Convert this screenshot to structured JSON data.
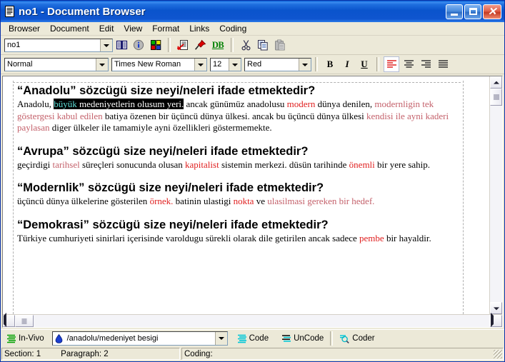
{
  "window": {
    "title": "no1 - Document Browser",
    "title_icon": "document-icon",
    "buttons": {
      "minimize": "minimize-button",
      "maximize": "maximize-button",
      "close": "close-button"
    }
  },
  "menubar": {
    "items": [
      {
        "label": "Browser"
      },
      {
        "label": "Document"
      },
      {
        "label": "Edit"
      },
      {
        "label": "View"
      },
      {
        "label": "Format"
      },
      {
        "label": "Links"
      },
      {
        "label": "Coding"
      }
    ]
  },
  "toolbar_main": {
    "document_combo": {
      "value": "no1"
    },
    "buttons": [
      {
        "name": "book-icon",
        "title": "Browse"
      },
      {
        "name": "info-icon",
        "title": "Properties"
      },
      {
        "name": "attributes-grid-icon",
        "title": "Attributes"
      },
      {
        "name": "document-export-icon",
        "title": "Export"
      },
      {
        "name": "pushpin-icon",
        "title": "Pin"
      },
      {
        "name": "db-icon",
        "title": "DB",
        "label": "DB"
      },
      {
        "name": "cut-icon",
        "title": "Cut"
      },
      {
        "name": "copy-icon",
        "title": "Copy"
      },
      {
        "name": "paste-icon",
        "title": "Paste"
      }
    ]
  },
  "toolbar_format": {
    "style_combo": {
      "value": "Normal"
    },
    "font_combo": {
      "value": "Times New Roman"
    },
    "size_combo": {
      "value": "12"
    },
    "color_combo": {
      "value": "Red"
    },
    "bold_label": "B",
    "italic_label": "I",
    "underline_label": "U",
    "align_buttons": [
      {
        "name": "align-left-button",
        "active": true
      },
      {
        "name": "align-center-button",
        "active": false
      },
      {
        "name": "align-right-button",
        "active": false
      },
      {
        "name": "align-justify-button",
        "active": false
      }
    ]
  },
  "document": {
    "sections": [
      {
        "heading": "“Anadolu” sözcügü size neyi/neleri ifade etmektedir?",
        "para_parts": [
          {
            "text": "Anadolu, ",
            "style": "plain"
          },
          {
            "text": "büyük",
            "style": "selected-teal"
          },
          {
            "text": " medeniyetlerin olusum yeri.",
            "style": "selected"
          },
          {
            "text": " ancak günümüz anadolusu ",
            "style": "plain"
          },
          {
            "text": "modern",
            "style": "red"
          },
          {
            "text": " dünya denilen, ",
            "style": "plain"
          },
          {
            "text": "modernligin tek göstergesi kabul edilen",
            "style": "red2"
          },
          {
            "text": " batiya özenen bir üçüncü dünya ülkesi. ancak bu üçüncü dünya ülkesi ",
            "style": "plain"
          },
          {
            "text": "kendisi ile ayni kaderi paylasan",
            "style": "red2"
          },
          {
            "text": " diger ülkeler ile tamamiyle ayni özellikleri göstermemekte.",
            "style": "plain"
          }
        ]
      },
      {
        "heading": "“Avrupa” sözcügü size neyi/neleri ifade etmektedir?",
        "para_parts": [
          {
            "text": "geçirdigi ",
            "style": "plain"
          },
          {
            "text": "tarihsel",
            "style": "red2"
          },
          {
            "text": " süreçleri sonucunda olusan ",
            "style": "plain"
          },
          {
            "text": "kapitalist",
            "style": "red"
          },
          {
            "text": " sistemin merkezi. düsün tarihinde ",
            "style": "plain"
          },
          {
            "text": "önemli",
            "style": "red"
          },
          {
            "text": " bir yere sahip.",
            "style": "plain"
          }
        ]
      },
      {
        "heading": "“Modernlik” sözcügü size neyi/neleri ifade etmektedir?",
        "para_parts": [
          {
            "text": "üçüncü dünya ülkelerine gösterilen ",
            "style": "plain"
          },
          {
            "text": "örnek.",
            "style": "red"
          },
          {
            "text": " batinin ulastigi ",
            "style": "plain"
          },
          {
            "text": "nokta",
            "style": "red"
          },
          {
            "text": " ve ",
            "style": "plain"
          },
          {
            "text": "ulasilmasi gereken bir hedef.",
            "style": "red2"
          }
        ]
      },
      {
        "heading": "“Demokrasi” sözcügü size neyi/neleri ifade etmektedir?",
        "para_parts": [
          {
            "text": "Türkiye cumhuriyeti sinirlari içerisinde varoldugu sürekli olarak dile getirilen ancak sadece ",
            "style": "plain"
          },
          {
            "text": "pembe",
            "style": "red"
          },
          {
            "text": " bir hayaldir.",
            "style": "plain"
          }
        ]
      }
    ]
  },
  "coding_bar": {
    "invivo_label": "In-Vivo",
    "node_combo": {
      "value": "/anadolu/medeniyet besigi"
    },
    "code_label": "Code",
    "uncode_label": "UnCode",
    "coder_label": "Coder"
  },
  "statusbar": {
    "section_label": "Section: 1",
    "paragraph_label": "Paragraph: 2",
    "coding_label": "Coding:"
  },
  "colors": {
    "title_blue": "#0a54cc",
    "red_bright": "#e02020",
    "red_muted": "#c4616b",
    "selection_bg": "#000000",
    "selection_teal": "#5fe0d8",
    "face": "#ece9d8"
  }
}
